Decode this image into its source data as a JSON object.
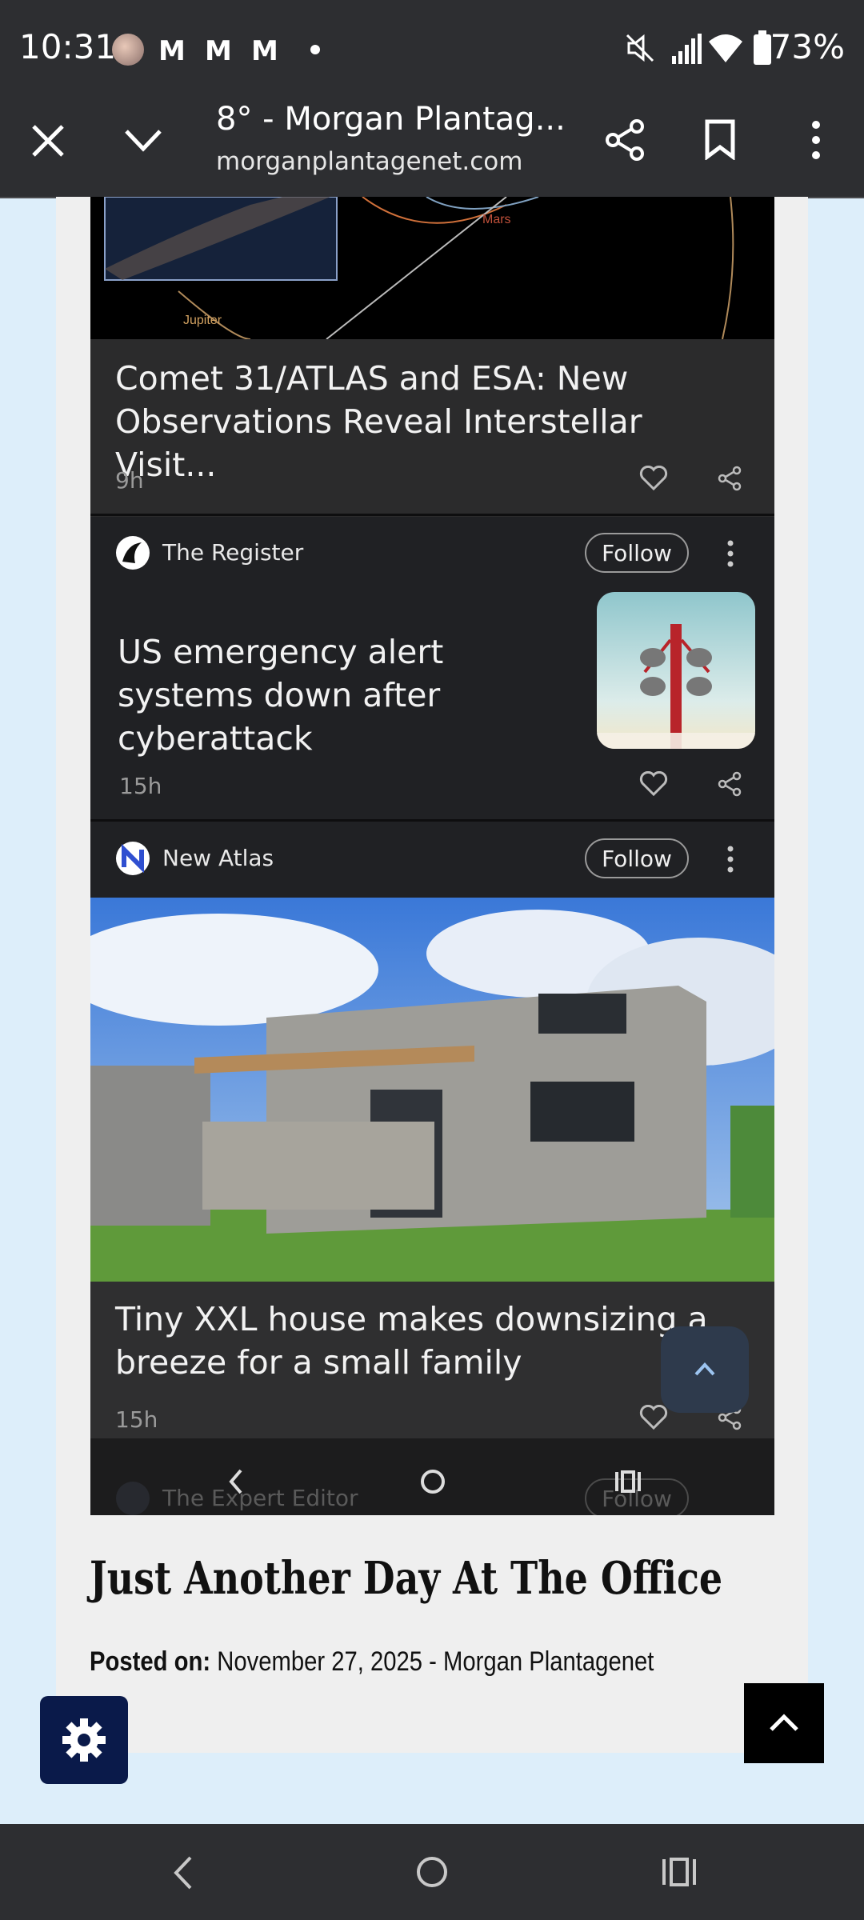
{
  "status_bar": {
    "time": "10:31",
    "battery": "73%",
    "notif_icons": [
      "M",
      "M",
      "M"
    ]
  },
  "browser": {
    "title": "8° - Morgan Plantag...",
    "url": "morganplantagenet.com"
  },
  "feed": {
    "cards": [
      {
        "headline": "Comet 31/ATLAS and ESA: New Observations Reveal Interstellar Visit...",
        "time": "9h",
        "image_labels": {
          "mars": "Mars",
          "jupiter": "Jupiter"
        }
      },
      {
        "source": "The Register",
        "follow": "Follow",
        "headline": "US emergency alert systems down after cyberattack",
        "time": "15h"
      },
      {
        "source": "New Atlas",
        "follow": "Follow",
        "headline": "Tiny XXL house makes downsizing a breeze for a small family",
        "time": "15h"
      },
      {
        "source": "The Expert Editor",
        "follow": "Follow"
      }
    ]
  },
  "post": {
    "title": "Just Another Day At The Office",
    "posted_label": "Posted on:",
    "posted_value": "November 27, 2025 - Morgan Plantagenet"
  },
  "colors": {
    "page_bg": "#ddeefa",
    "card_bg": "#202124",
    "settings_btn": "#0a1a4a",
    "top_btn": "#000000"
  }
}
